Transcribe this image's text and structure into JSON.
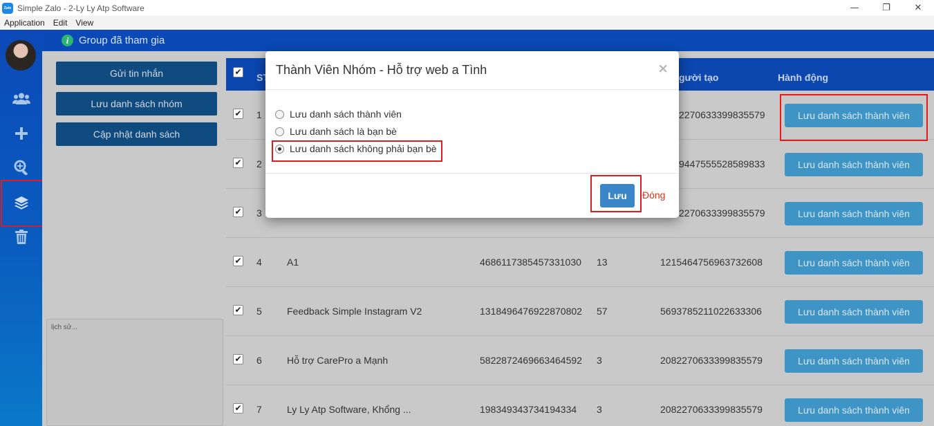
{
  "window": {
    "title": "Simple Zalo - 2-Ly Ly Atp Software",
    "logo_text": "Zalo",
    "minimize": "—",
    "restore": "❐",
    "close": "✕"
  },
  "menu": [
    "Application",
    "Edit",
    "View"
  ],
  "header": {
    "info_icon": "i",
    "title": "Group đã tham gia"
  },
  "sidebar": {
    "icons": [
      "users-icon",
      "plus-icon",
      "search-plus-icon",
      "layers-icon",
      "trash-icon"
    ]
  },
  "left_panel": {
    "send_message": "Gửi tin nhắn",
    "save_group_list": "Lưu danh sách nhóm",
    "update_list": "Cập nhật danh sách",
    "history_placeholder": "lịch sử..."
  },
  "table": {
    "headers": {
      "stt": "ST",
      "creator": "gười tạo",
      "action": "Hành động"
    },
    "rows": [
      {
        "stt": "1",
        "name": "",
        "id": "",
        "members": "",
        "creator": "2270633399835579",
        "action": "Lưu danh sách thành viên"
      },
      {
        "stt": "2",
        "name": "",
        "id": "",
        "members": "",
        "creator": "9447555528589833",
        "action": "Lưu danh sách thành viên"
      },
      {
        "stt": "3",
        "name": "",
        "id": "",
        "members": "",
        "creator": "2270633399835579",
        "action": "Lưu danh sách thành viên"
      },
      {
        "stt": "4",
        "name": "A1",
        "id": "4686117385457331030",
        "members": "13",
        "creator": "1215464756963732608",
        "action": "Lưu danh sách thành viên"
      },
      {
        "stt": "5",
        "name": "Feedback Simple Instagram V2",
        "id": "1318496476922870802",
        "members": "57",
        "creator": "5693785211022633306",
        "action": "Lưu danh sách thành viên"
      },
      {
        "stt": "6",
        "name": "Hỗ trợ CarePro a Mạnh",
        "id": "5822872469663464592",
        "members": "3",
        "creator": "2082270633399835579",
        "action": "Lưu danh sách thành viên"
      },
      {
        "stt": "7",
        "name": "Ly Ly Atp Software, Khổng ...",
        "id": "198349343734194334",
        "members": "3",
        "creator": "2082270633399835579",
        "action": "Lưu danh sách thành viên"
      }
    ]
  },
  "modal": {
    "title": "Thành Viên Nhóm - Hỗ trợ web a Tình",
    "close_icon": "×",
    "options": [
      {
        "label": "Lưu danh sách thành viên",
        "checked": false
      },
      {
        "label": "Lưu danh sách là bạn bè",
        "checked": false
      },
      {
        "label": "Lưu danh sách không phải bạn bè",
        "checked": true
      }
    ],
    "save_label": "Lưu",
    "close_label": "Đóng"
  },
  "colors": {
    "header_blue": "#0b49b7",
    "highlight_red": "#e01c1c",
    "row_button": "#3e94c4",
    "save_button": "#3a86c8"
  }
}
